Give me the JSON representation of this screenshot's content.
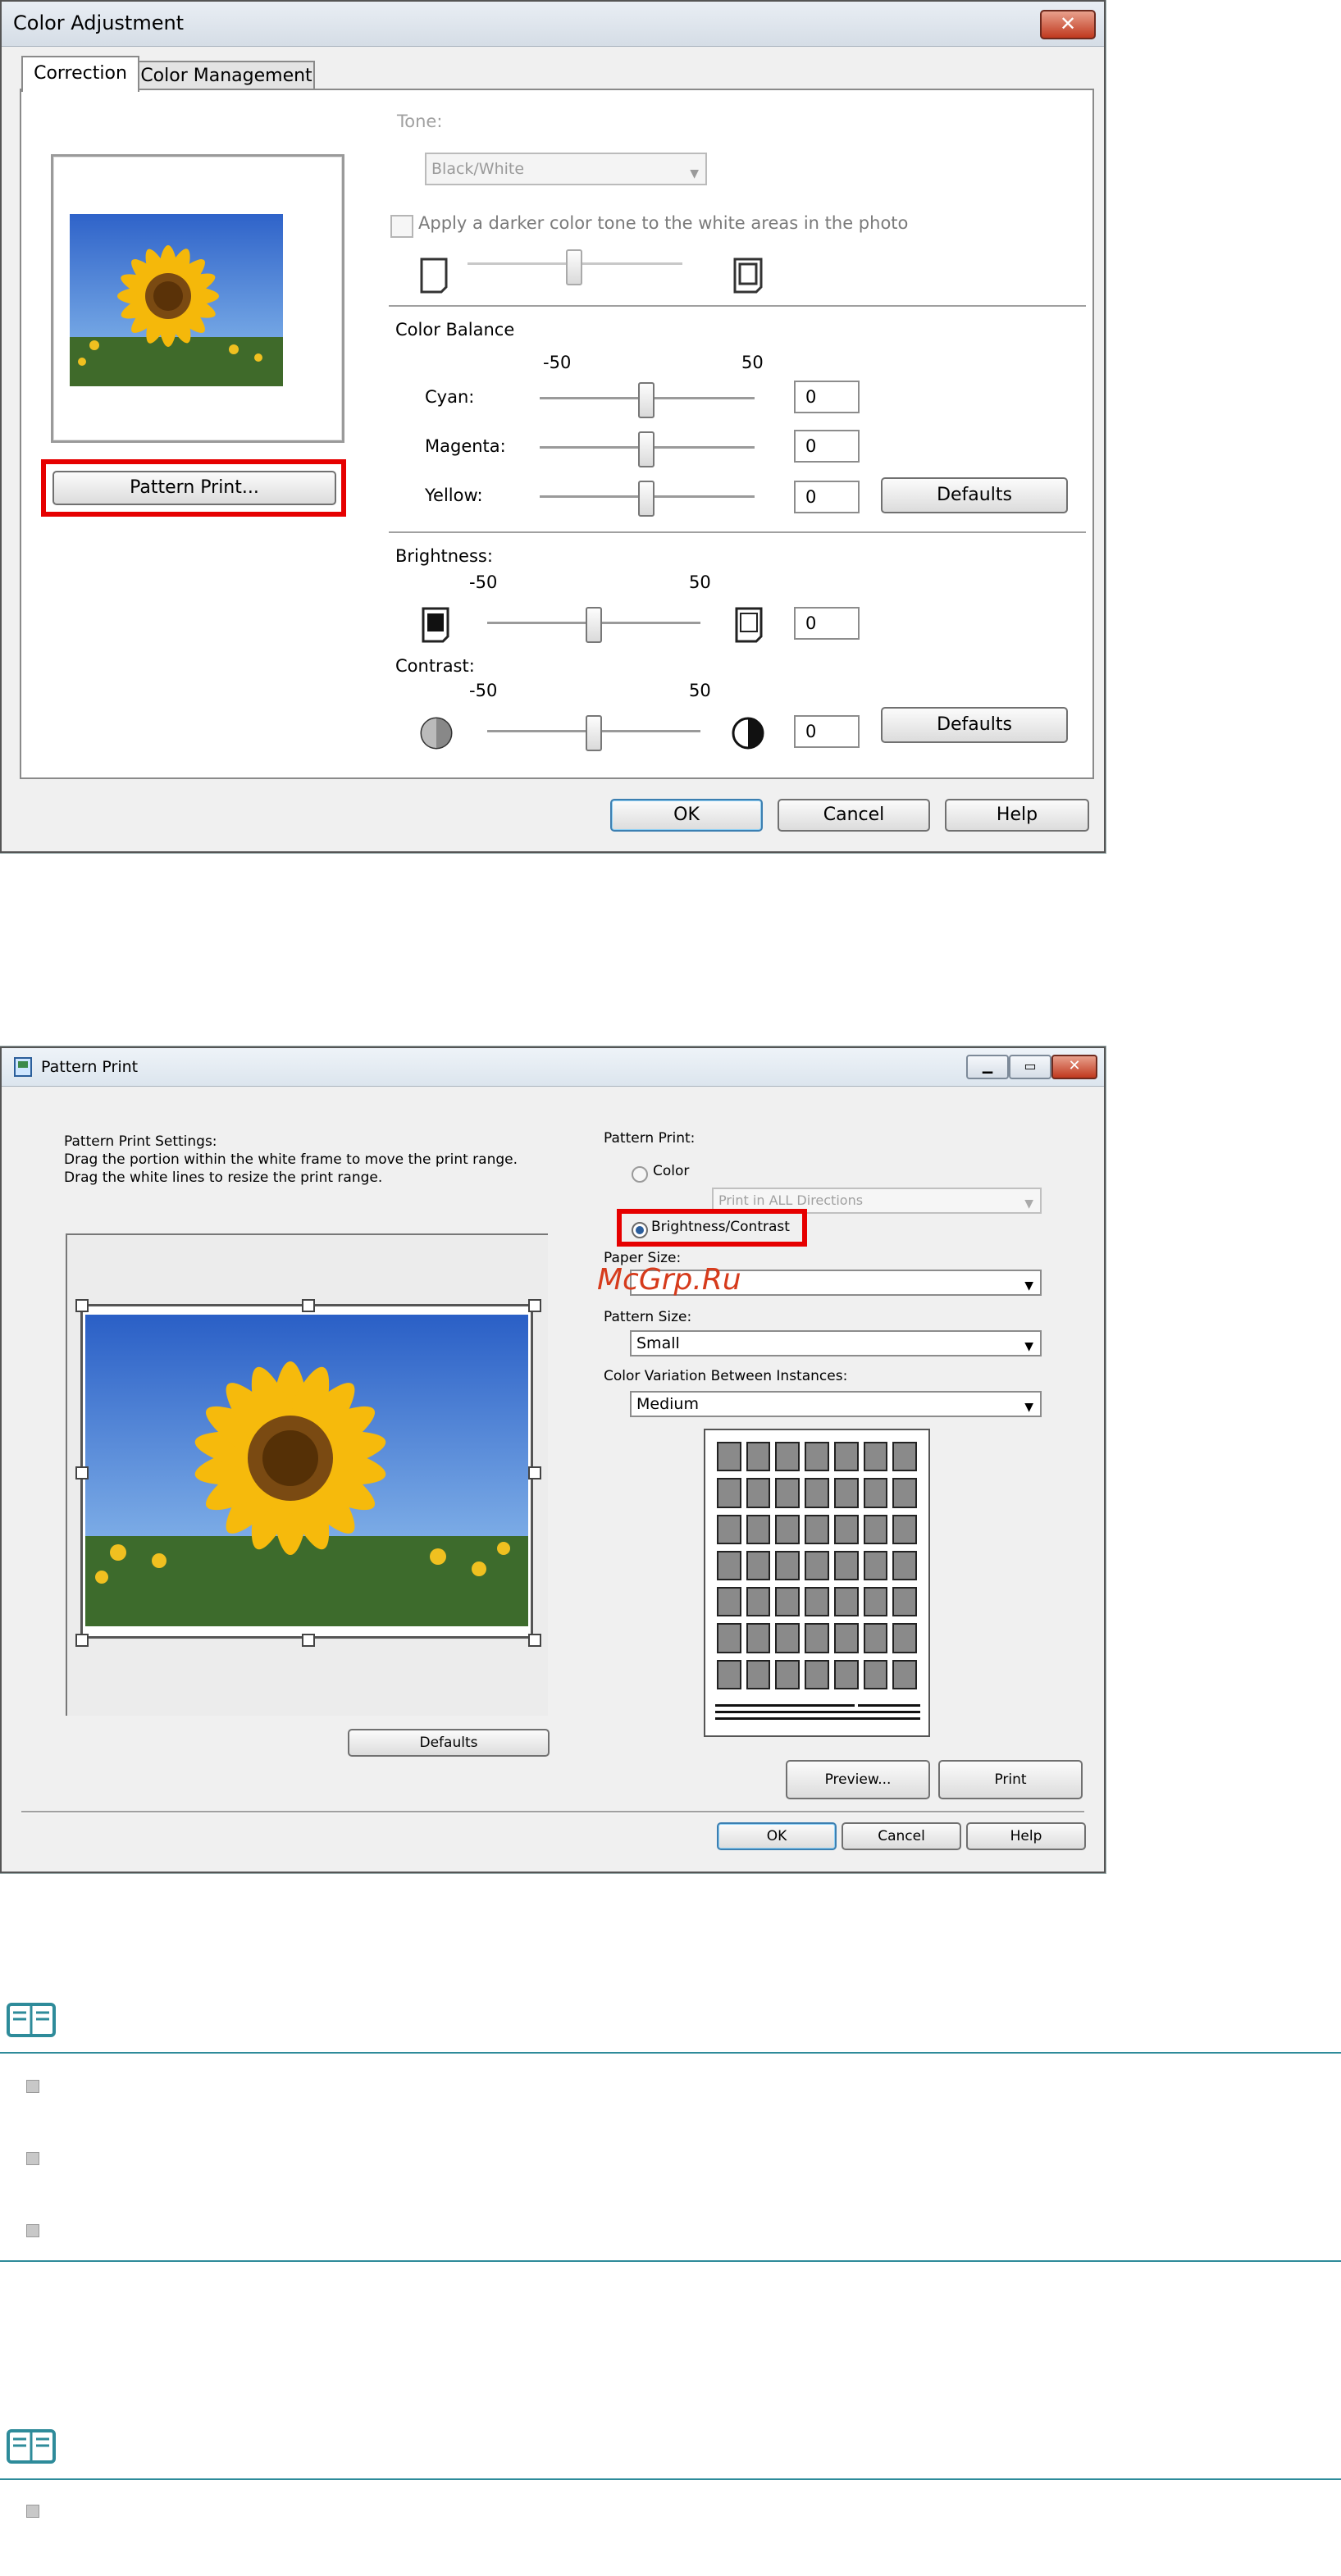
{
  "color_adjustment": {
    "title": "Color Adjustment",
    "tabs": [
      "Correction",
      "Color Management"
    ],
    "tone_label": "Tone:",
    "tone_value": "Black/White",
    "darker_checkbox_label": "Apply a darker color tone to the white areas in the photo",
    "color_balance_label": "Color Balance",
    "range_min": "-50",
    "range_max": "50",
    "cyan_label": "Cyan:",
    "cyan_value": "0",
    "magenta_label": "Magenta:",
    "magenta_value": "0",
    "yellow_label": "Yellow:",
    "yellow_value": "0",
    "defaults_label": "Defaults",
    "brightness_label": "Brightness:",
    "brightness_value": "0",
    "contrast_label": "Contrast:",
    "contrast_value": "0",
    "pattern_print_button": "Pattern Print...",
    "ok": "OK",
    "cancel": "Cancel",
    "help": "Help",
    "highlight_color": "#e60000"
  },
  "pattern_print": {
    "title": "Pattern Print",
    "settings_title": "Pattern Print Settings:",
    "instruction_1": "Drag the portion within the white frame to move the print range.",
    "instruction_2": "Drag the white lines to resize the print range.",
    "pattern_print_label": "Pattern Print:",
    "option_color": "Color",
    "direction_select": "Print in ALL Directions",
    "option_brightness_contrast": "Brightness/Contrast",
    "paper_size_label": "Paper Size:",
    "paper_size_value": "",
    "pattern_size_label": "Pattern Size:",
    "pattern_size_value": "Small",
    "color_variation_label": "Color Variation Between Instances:",
    "color_variation_value": "Medium",
    "watermark": "McGrp.Ru",
    "defaults": "Defaults",
    "preview": "Preview...",
    "print": "Print",
    "ok": "OK",
    "cancel": "Cancel",
    "help": "Help",
    "grid_rows": 7,
    "grid_cols": 7
  },
  "notes": {
    "accent_color": "#2e8b9a"
  }
}
